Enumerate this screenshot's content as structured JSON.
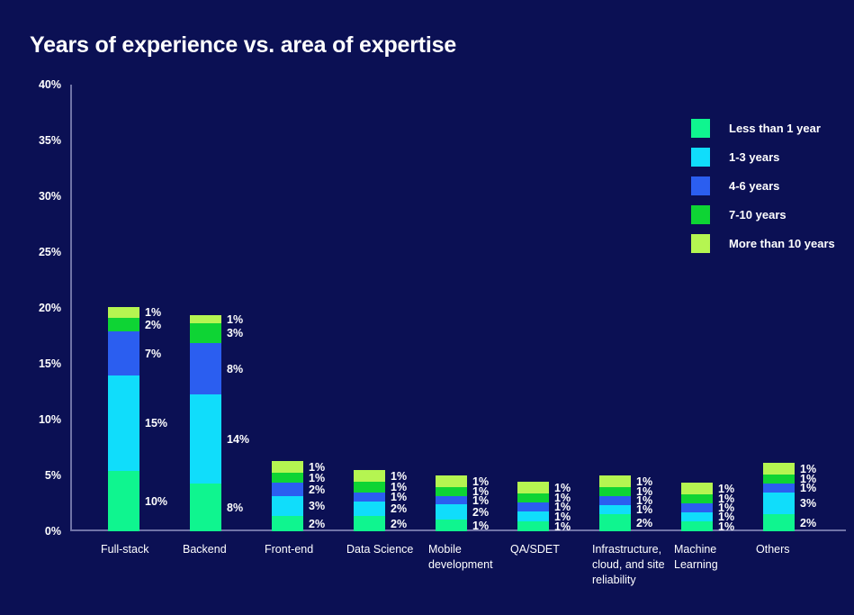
{
  "chart_data": {
    "type": "bar",
    "stacked": true,
    "title": "Years of experience vs. area of expertise",
    "xlabel": "",
    "ylabel": "",
    "ylim": [
      0,
      40
    ],
    "y_ticks": [
      "0%",
      "5%",
      "10%",
      "15%",
      "20%",
      "25%",
      "30%",
      "35%",
      "40%"
    ],
    "y_tick_values": [
      0,
      5,
      10,
      15,
      20,
      25,
      30,
      35,
      40
    ],
    "grid": false,
    "legend_position": "right",
    "categories": [
      "Full-stack",
      "Backend",
      "Front-end",
      "Data Science",
      "Mobile development",
      "QA/SDET",
      "Infrastructure, cloud, and site reliability",
      "Machine Learning",
      "Others"
    ],
    "series": [
      {
        "name": "Less than 1 year",
        "color": "#0ff58f",
        "values": [
          10,
          8,
          2,
          2,
          1,
          1,
          2,
          1,
          2
        ],
        "labels": [
          "10%",
          "8%",
          "2%",
          "2%",
          "1%",
          "1%",
          "2%",
          "1%",
          "2%"
        ]
      },
      {
        "name": "1-3 years",
        "color": "#10ddfb",
        "values": [
          15,
          14,
          3,
          2,
          2,
          1,
          1,
          1,
          3
        ],
        "labels": [
          "15%",
          "14%",
          "3%",
          "2%",
          "2%",
          "1%",
          "1%",
          "1%",
          "3%"
        ]
      },
      {
        "name": "4-6 years",
        "color": "#2b5ef0",
        "values": [
          7,
          8,
          2,
          1,
          1,
          1,
          1,
          1,
          1
        ],
        "labels": [
          "7%",
          "8%",
          "2%",
          "1%",
          "1%",
          "1%",
          "1%",
          "1%",
          "1%"
        ]
      },
      {
        "name": "7-10 years",
        "color": "#0ed434",
        "values": [
          2,
          3,
          1,
          1,
          1,
          1,
          1,
          1,
          1
        ],
        "labels": [
          "2%",
          "3%",
          "1%",
          "1%",
          "1%",
          "1%",
          "1%",
          "1%",
          "1%"
        ]
      },
      {
        "name": "More than 10 years",
        "color": "#b5f551",
        "values": [
          1,
          1,
          1,
          1,
          1,
          1,
          1,
          1,
          1
        ],
        "labels": [
          "1%",
          "1%",
          "1%",
          "1%",
          "1%",
          "1%",
          "1%",
          "1%",
          "1%"
        ]
      }
    ],
    "bar_pixel_heights": [
      [
        67,
        106,
        49,
        15,
        12
      ],
      [
        53,
        99,
        57,
        22,
        9
      ],
      [
        17,
        22,
        15,
        11,
        13
      ],
      [
        17,
        16,
        10,
        12,
        13
      ],
      [
        13,
        17,
        9,
        10,
        13
      ],
      [
        11,
        11,
        10,
        10,
        13
      ],
      [
        19,
        10,
        10,
        10,
        13
      ],
      [
        11,
        10,
        10,
        10,
        13
      ],
      [
        19,
        24,
        10,
        10,
        13
      ]
    ]
  },
  "colors": {
    "background": "#0b1054",
    "axis": "#6f73a6",
    "text": "#ffffff"
  }
}
